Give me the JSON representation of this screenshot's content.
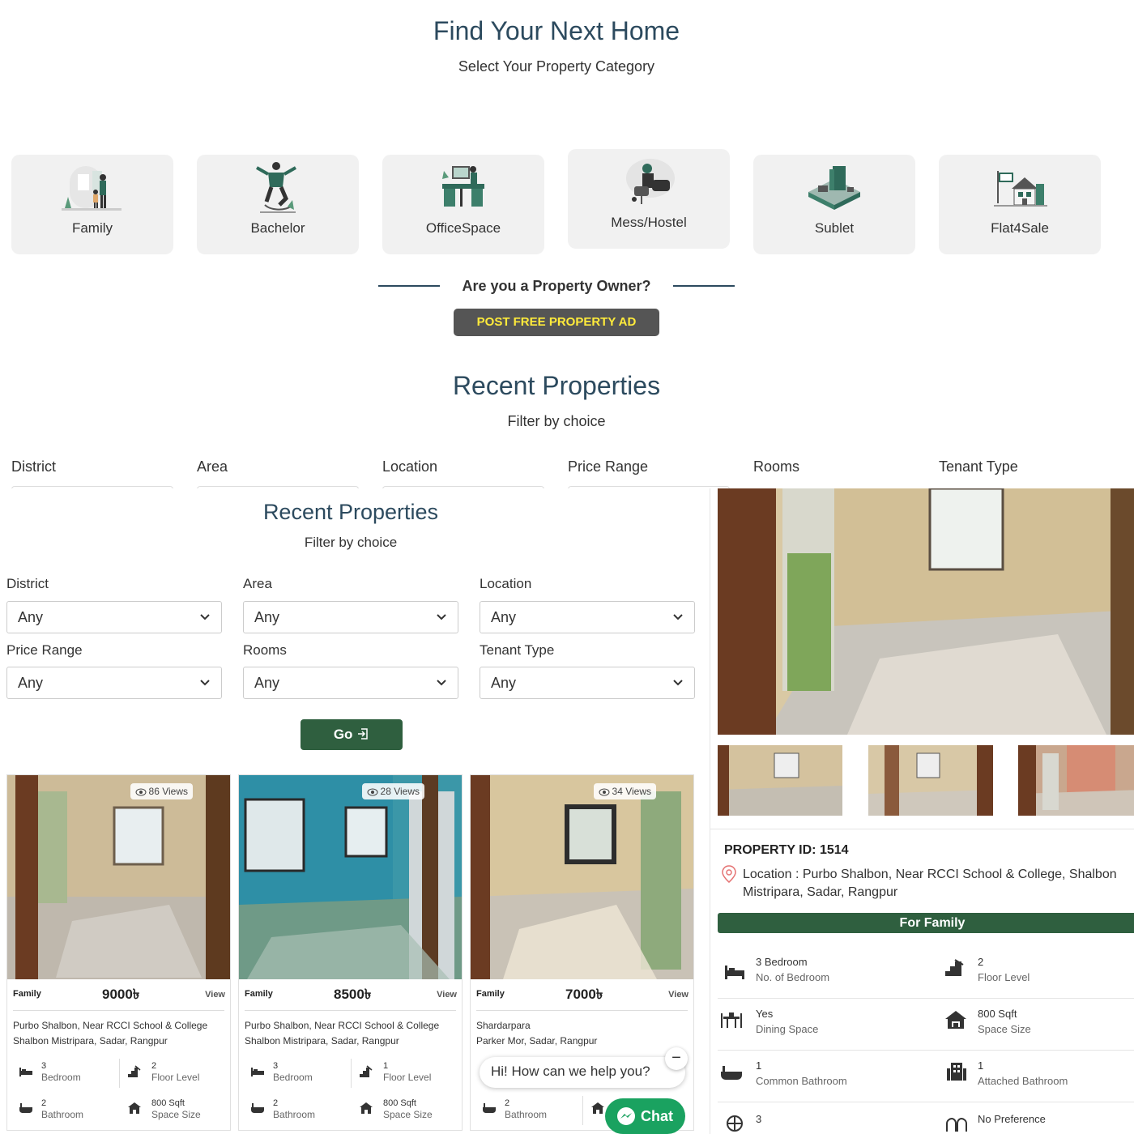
{
  "hero": {
    "title": "Find Your Next Home",
    "subtitle": "Select Your Property Category"
  },
  "categories": [
    {
      "label": "Family",
      "icon": "family-illustration"
    },
    {
      "label": "Bachelor",
      "icon": "bachelor-illustration"
    },
    {
      "label": "OfficeSpace",
      "icon": "office-illustration"
    },
    {
      "label": "Mess/Hostel",
      "icon": "hostel-illustration"
    },
    {
      "label": "Sublet",
      "icon": "sublet-illustration"
    },
    {
      "label": "Flat4Sale",
      "icon": "flat-sale-illustration"
    }
  ],
  "owner": {
    "question": "Are you a Property Owner?",
    "button": "POST FREE PROPERTY AD"
  },
  "recent": {
    "title": "Recent Properties",
    "subtitle": "Filter by choice",
    "filters": [
      "District",
      "Area",
      "Location",
      "Price Range",
      "Rooms",
      "Tenant Type"
    ]
  },
  "overlay": {
    "title": "Recent Properties",
    "subtitle": "Filter by choice",
    "filters": [
      {
        "label": "District",
        "value": "Any"
      },
      {
        "label": "Area",
        "value": "Any"
      },
      {
        "label": "Location",
        "value": "Any"
      },
      {
        "label": "Price Range",
        "value": "Any"
      },
      {
        "label": "Rooms",
        "value": "Any"
      },
      {
        "label": "Tenant Type",
        "value": "Any"
      }
    ],
    "go_button": "Go"
  },
  "cards": [
    {
      "views": "86 Views",
      "type": "Family",
      "price": "9000৳",
      "view": "View",
      "address_1": "Purbo Shalbon, Near RCCI School & College",
      "address_2": "Shalbon Mistripara, Sadar, Rangpur",
      "bedroom_value": "3",
      "bedroom_label": "Bedroom",
      "floor_value": "2",
      "floor_label": "Floor Level",
      "bath_value": "2",
      "bath_label": "Bathroom",
      "size_value": "800 Sqft",
      "size_label": "Space Size"
    },
    {
      "views": "28 Views",
      "type": "Family",
      "price": "8500৳",
      "view": "View",
      "address_1": "Purbo Shalbon, Near RCCI School & College",
      "address_2": "Shalbon Mistripara, Sadar, Rangpur",
      "bedroom_value": "3",
      "bedroom_label": "Bedroom",
      "floor_value": "1",
      "floor_label": "Floor Level",
      "bath_value": "2",
      "bath_label": "Bathroom",
      "size_value": "800 Sqft",
      "size_label": "Space Size"
    },
    {
      "views": "34 Views",
      "type": "Family",
      "price": "7000৳",
      "view": "View",
      "address_1": "Shardarpara",
      "address_2": "Parker Mor, Sadar, Rangpur",
      "bath_value": "2",
      "bath_label": "Bathroom"
    }
  ],
  "chat": {
    "bubble": "Hi! How can we help you?",
    "minimize": "−",
    "button": "Chat"
  },
  "detail": {
    "property_id": "PROPERTY ID: 1514",
    "location_1": "Location : Purbo Shalbon, Near RCCI School & College, Shalbon",
    "location_2": "Mistripara, Sadar, Rangpur",
    "category": "For Family",
    "specs": [
      {
        "value": "3 Bedroom",
        "label": "No. of Bedroom",
        "icon": "bed-icon"
      },
      {
        "value": "2",
        "label": "Floor Level",
        "icon": "stairs-icon"
      },
      {
        "value": "Yes",
        "label": "Dining Space",
        "icon": "dining-icon"
      },
      {
        "value": "800 Sqft",
        "label": "Space Size",
        "icon": "house-icon"
      },
      {
        "value": "1",
        "label": "Common Bathroom",
        "icon": "bathtub-icon"
      },
      {
        "value": "1",
        "label": "Attached Bathroom",
        "icon": "building-icon"
      },
      {
        "value": "3",
        "label": "",
        "icon": "balcony-icon"
      },
      {
        "value": "No Preference",
        "label": "",
        "icon": "tenant-icon"
      }
    ]
  },
  "colors": {
    "heading": "#2c4a5e",
    "accent_green": "#2f5f3f",
    "post_button_bg": "#555555",
    "post_button_text": "#ffeb3b",
    "chat_green": "#1aa260"
  }
}
